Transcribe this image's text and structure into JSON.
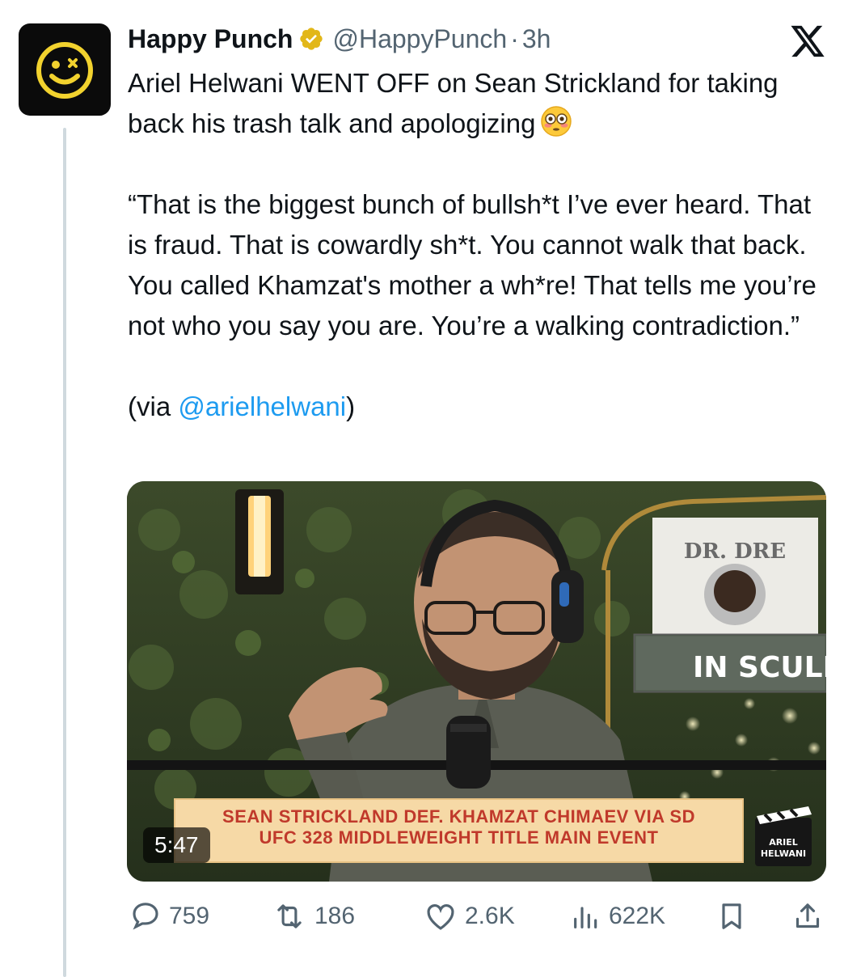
{
  "tweet": {
    "author_name": "Happy Punch",
    "handle": "@HappyPunch",
    "separator": "·",
    "time": "3h",
    "line1": "Ariel Helwani WENT OFF on Sean Strickland for taking back his trash talk and apologizing",
    "quote": "“That is the biggest bunch of bullsh*t I’ve ever heard. That is fraud. That is cowardly sh*t. You cannot walk that back. You called Khamzat's mother a wh*re! That tells me you’re not who you say you are. You’re a walking contradiction.”",
    "via_prefix": "(via ",
    "via_mention": "@arielhelwani",
    "via_suffix": ")"
  },
  "media": {
    "banner_line1": "SEAN STRICKLAND DEF. KHAMZAT CHIMAEV VIA SD",
    "banner_line2": "UFC 328 MIDDLEWEIGHT TITLE MAIN EVENT",
    "duration": "5:47",
    "poster_title": "DR. DRE",
    "sign_text": "IN SCULLY",
    "corner_logo_text": "ARIEL HELWANI"
  },
  "stats": {
    "replies": "759",
    "reposts": "186",
    "likes": "2.6K",
    "views": "622K"
  },
  "colors": {
    "link": "#1d9bf0",
    "muted": "#536471",
    "verified_gold": "#e2b719",
    "avatar_smile": "#f2d22e"
  },
  "icons": [
    "happy-face-icon",
    "verified-badge-icon",
    "x-logo-icon",
    "flushed-emoji-icon",
    "reply-icon",
    "repost-icon",
    "like-icon",
    "views-icon",
    "bookmark-icon",
    "share-icon"
  ]
}
